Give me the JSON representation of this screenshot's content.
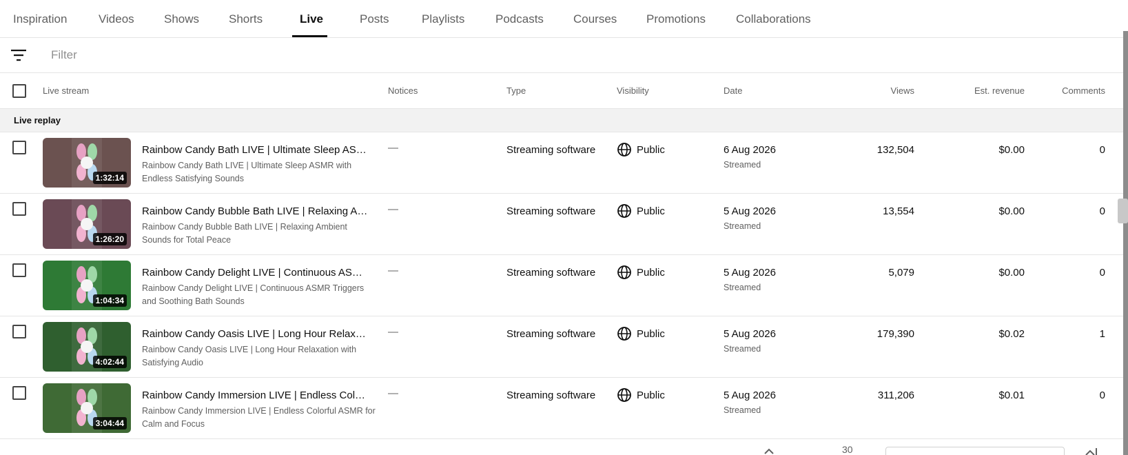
{
  "tabs": [
    {
      "label": "Inspiration"
    },
    {
      "label": "Videos"
    },
    {
      "label": "Shows"
    },
    {
      "label": "Shorts"
    },
    {
      "label": "Live"
    },
    {
      "label": "Posts"
    },
    {
      "label": "Playlists"
    },
    {
      "label": "Podcasts"
    },
    {
      "label": "Courses"
    },
    {
      "label": "Promotions"
    },
    {
      "label": "Collaborations"
    }
  ],
  "active_tab": "Live",
  "filter": {
    "placeholder": "Filter",
    "icon": "filter-icon"
  },
  "table": {
    "columns": {
      "live_stream": "Live stream",
      "notices": "Notices",
      "type": "Type",
      "visibility": "Visibility",
      "date": "Date",
      "views": "Views",
      "revenue": "Est. revenue",
      "comments": "Comments"
    },
    "group_label": "Live replay",
    "rows": [
      {
        "duration": "1:32:14",
        "title": "Rainbow Candy Bath LIVE | Ultimate Sleep ASMR with Endless Satisfying Sounds",
        "description": "Rainbow Candy Bath LIVE | Ultimate Sleep ASMR with Endless Satisfying Sounds",
        "notices": "—",
        "type": "Streaming software",
        "visibility": "Public",
        "date": "6 Aug 2026",
        "date_sub": "Streamed",
        "views": "132,504",
        "revenue": "$0.00",
        "comments": "0",
        "thumb_color": "#6b5250"
      },
      {
        "duration": "1:26:20",
        "title": "Rainbow Candy Bubble Bath LIVE | Relaxing Ambient Sounds for Total Peace",
        "description": "Rainbow Candy Bubble Bath LIVE | Relaxing Ambient Sounds for Total Peace",
        "notices": "—",
        "type": "Streaming software",
        "visibility": "Public",
        "date": "5 Aug 2026",
        "date_sub": "Streamed",
        "views": "13,554",
        "revenue": "$0.00",
        "comments": "0",
        "thumb_color": "#6a4a55"
      },
      {
        "duration": "1:04:34",
        "title": "Rainbow Candy Delight LIVE | Continuous ASMR Triggers and Soothing Bath Sounds",
        "description": "Rainbow Candy Delight LIVE | Continuous ASMR Triggers and Soothing Bath Sounds",
        "notices": "—",
        "type": "Streaming software",
        "visibility": "Public",
        "date": "5 Aug 2026",
        "date_sub": "Streamed",
        "views": "5,079",
        "revenue": "$0.00",
        "comments": "0",
        "thumb_color": "#2e7a35"
      },
      {
        "duration": "4:02:44",
        "title": "Rainbow Candy Oasis LIVE | Long Hour Relaxation with Satisfying Audio",
        "description": "Rainbow Candy Oasis LIVE | Long Hour Relaxation with Satisfying Audio",
        "notices": "—",
        "type": "Streaming software",
        "visibility": "Public",
        "date": "5 Aug 2026",
        "date_sub": "Streamed",
        "views": "179,390",
        "revenue": "$0.02",
        "comments": "1",
        "thumb_color": "#2f5f2f"
      },
      {
        "duration": "3:04:44",
        "title": "Rainbow Candy Immersion LIVE | Endless Colorful ASMR for Calm and Focus",
        "description": "Rainbow Candy Immersion LIVE | Endless Colorful ASMR for Calm and Focus",
        "notices": "—",
        "type": "Streaming software",
        "visibility": "Public",
        "date": "5 Aug 2026",
        "date_sub": "Streamed",
        "views": "311,206",
        "revenue": "$0.01",
        "comments": "0",
        "thumb_color": "#3f6a35"
      }
    ]
  },
  "footer": {
    "rows_per_page_value": "30"
  }
}
